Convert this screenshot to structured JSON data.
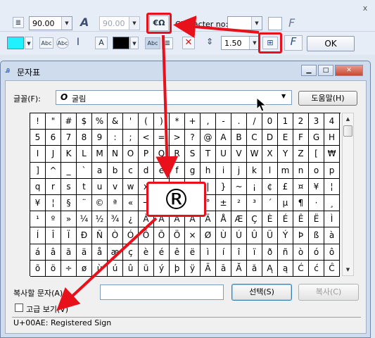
{
  "toolbar": {
    "row1": {
      "font_size_value": "90.00",
      "font_size2_value": "90.00",
      "charmap_button_label": "€Ω",
      "character_no_label": "Character no:",
      "close_label": "x"
    },
    "row2": {
      "line_spacing_value": "1.50",
      "ok_label": "OK",
      "highlight_color": "#20f0ff",
      "text_color": "#000000"
    }
  },
  "dialog": {
    "title": "문자표",
    "font_label": "글꼴(F):",
    "font_value": "굴림",
    "font_icon": "O",
    "help_button": "도움말(H)",
    "characters": [
      [
        "!",
        "\"",
        "#",
        "$",
        "%",
        "&",
        "'",
        "(",
        ")",
        "*",
        "+",
        ",",
        "-",
        ".",
        "/",
        "0",
        "1",
        "2",
        "3",
        "4"
      ],
      [
        "5",
        "6",
        "7",
        "8",
        "9",
        ":",
        ";",
        "<",
        "=",
        ">",
        "?",
        "@",
        "A",
        "B",
        "C",
        "D",
        "E",
        "F",
        "G",
        "H"
      ],
      [
        "I",
        "J",
        "K",
        "L",
        "M",
        "N",
        "O",
        "P",
        "Q",
        "R",
        "S",
        "T",
        "U",
        "V",
        "W",
        "X",
        "Y",
        "Z",
        "[",
        "₩"
      ],
      [
        "]",
        "^",
        "_",
        "`",
        "a",
        "b",
        "c",
        "d",
        "e",
        "f",
        "g",
        "h",
        "i",
        "j",
        "k",
        "l",
        "m",
        "n",
        "o",
        "p"
      ],
      [
        "q",
        "r",
        "s",
        "t",
        "u",
        "v",
        "w",
        "x",
        "y",
        "z",
        "{",
        "|",
        "}",
        "~",
        "¡",
        "¢",
        "£",
        "¤",
        "¥",
        "¦"
      ],
      [
        "¥",
        "¦",
        "§",
        "¨",
        "©",
        "ª",
        "«",
        "¬",
        "­",
        "®",
        "¯",
        "°",
        "±",
        "²",
        "³",
        "´",
        "µ",
        "¶",
        "·",
        "¸"
      ],
      [
        "¹",
        "º",
        "»",
        "¼",
        "½",
        "¾",
        "¿",
        "À",
        "Á",
        "Â",
        "Ã",
        "Ä",
        "Å",
        "Æ",
        "Ç",
        "È",
        "É",
        "Ê",
        "Ë",
        "Ì"
      ],
      [
        "Í",
        "Î",
        "Ï",
        "Ð",
        "Ñ",
        "Ò",
        "Ó",
        "Ô",
        "Õ",
        "Ö",
        "×",
        "Ø",
        "Ù",
        "Ú",
        "Û",
        "Ü",
        "Ý",
        "Þ",
        "ß",
        "à"
      ],
      [
        "á",
        "â",
        "ã",
        "ä",
        "å",
        "æ",
        "ç",
        "è",
        "é",
        "ê",
        "ë",
        "ì",
        "í",
        "î",
        "ï",
        "ð",
        "ñ",
        "ò",
        "ó",
        "ô"
      ],
      [
        "õ",
        "ö",
        "÷",
        "ø",
        "ù",
        "ú",
        "û",
        "ü",
        "ý",
        "þ",
        "ÿ",
        "Ā",
        "ā",
        "Ă",
        "ă",
        "Ą",
        "ą",
        "Ć",
        "ć",
        "Ĉ"
      ]
    ],
    "zoom_char": "®",
    "copy_label": "복사할 문자(A):",
    "copy_value": "",
    "select_button": "선택(S)",
    "copy_button": "복사(C)",
    "advanced_label": "고급 보기(V)",
    "status": "U+00AE: Registered Sign"
  },
  "colors": {
    "highlight": "#e8101a"
  }
}
